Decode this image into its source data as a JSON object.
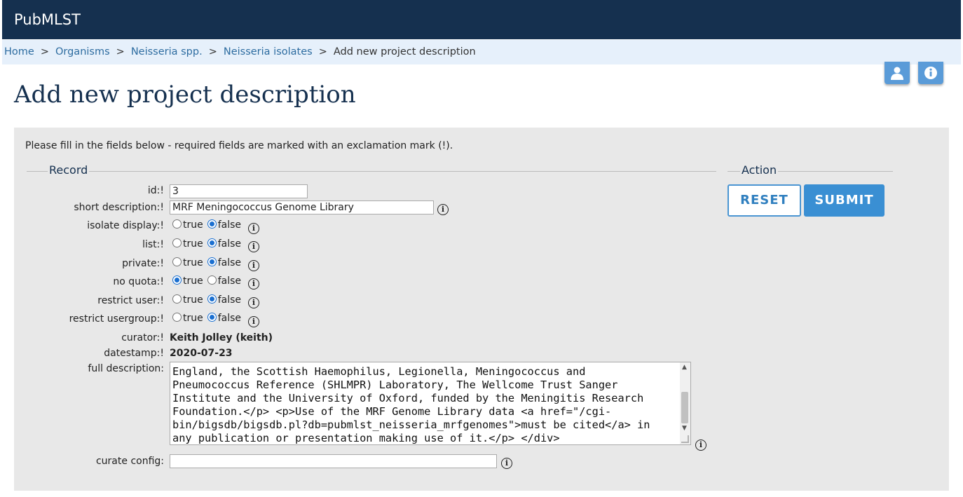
{
  "app": {
    "title": "PubMLST"
  },
  "breadcrumb": [
    {
      "label": "Home",
      "link": true
    },
    {
      "label": "Organisms",
      "link": true
    },
    {
      "label": "Neisseria spp.",
      "link": true
    },
    {
      "label": "Neisseria isolates",
      "link": true
    },
    {
      "label": "Add new project description",
      "link": false
    }
  ],
  "breadcrumb_sep": ">",
  "page": {
    "title": "Add new project description"
  },
  "form": {
    "intro": "Please fill in the fields below - required fields are marked with an exclamation mark (!).",
    "record_legend": "Record",
    "action_legend": "Action",
    "fields": {
      "id": {
        "label": "id:!",
        "value": "3"
      },
      "short_description": {
        "label": "short description:!",
        "value": "MRF Meningococcus Genome Library"
      },
      "isolate_display": {
        "label": "isolate display:!",
        "selected": "false"
      },
      "list": {
        "label": "list:!",
        "selected": "false"
      },
      "private": {
        "label": "private:!",
        "selected": "false"
      },
      "no_quota": {
        "label": "no quota:!",
        "selected": "true"
      },
      "restrict_user": {
        "label": "restrict user:!",
        "selected": "false"
      },
      "restrict_usergroup": {
        "label": "restrict usergroup:!",
        "selected": "false"
      },
      "curator": {
        "label": "curator:!",
        "value": "Keith Jolley (keith)"
      },
      "datestamp": {
        "label": "datestamp:!",
        "value": "2020-07-23"
      },
      "full_description": {
        "label": "full description:",
        "visible_text": "England, the Scottish Haemophilus, Legionella, Meningococcus and\nPneumococcus Reference (SHLMPR) Laboratory, The Wellcome Trust Sanger\nInstitute and the University of Oxford, funded by the Meningitis Research\nFoundation.</p> <p>Use of the MRF Genome Library data <a href=\"/cgi-\nbin/bigsdb/bigsdb.pl?db=pubmlst_neisseria_mrfgenomes\">must be cited</a> in\nany publication or presentation making use of it.</p> </div>"
      },
      "curate_config": {
        "label": "curate config:",
        "value": ""
      }
    },
    "radio_true_label": "true",
    "radio_false_label": "false",
    "buttons": {
      "reset": "RESET",
      "submit": "SUBMIT"
    }
  },
  "icons": {
    "info": "info-icon",
    "user": "user-icon",
    "about": "info-icon"
  },
  "colors": {
    "header": "#15304f",
    "breadcrumb_bg": "#e6f0fb",
    "accent": "#3a8fd3",
    "panel": "#e8e8e8"
  }
}
